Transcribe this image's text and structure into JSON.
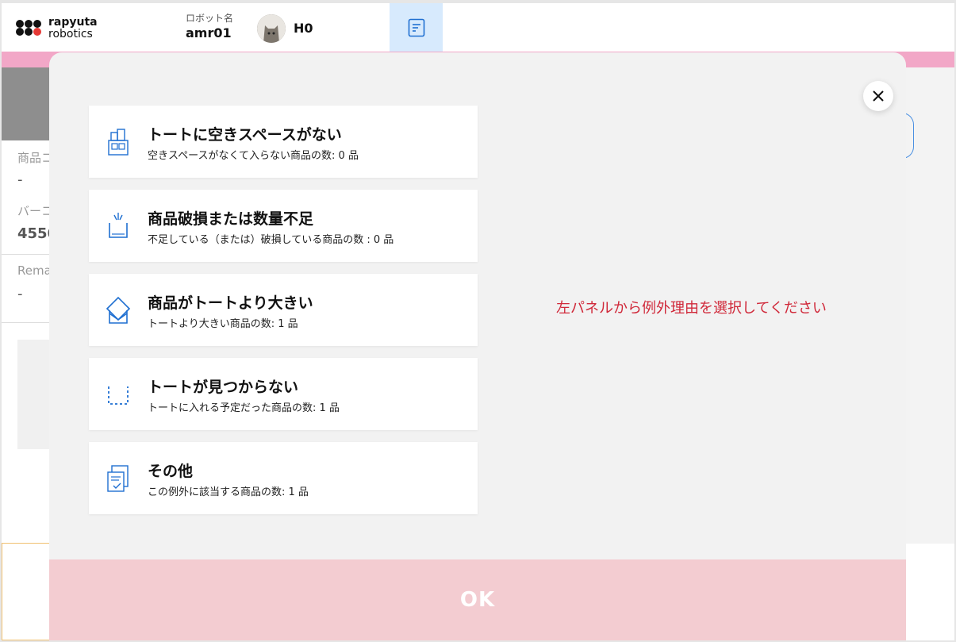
{
  "header": {
    "brand_line1": "rapyuta",
    "brand_line2": "robotics",
    "robot_label": "ロボット名",
    "robot_name": "amr01",
    "user_name": "H0"
  },
  "background": {
    "label_product": "商品コ",
    "value_product": "-",
    "label_barcode": "バーコ",
    "value_barcode": "4550",
    "label_remarks": "Rema",
    "value_remarks": "-"
  },
  "modal": {
    "reasons": [
      {
        "icon": "tote-full-icon",
        "title": "トートに空きスペースがない",
        "subtitle": "空きスペースがなくて入らない商品の数: 0 品"
      },
      {
        "icon": "damaged-item-icon",
        "title": "商品破損または数量不足",
        "subtitle": "不足している（または）破損している商品の数 : 0 品"
      },
      {
        "icon": "oversized-item-icon",
        "title": "商品がトートより大きい",
        "subtitle": "トートより大きい商品の数: 1 品"
      },
      {
        "icon": "missing-tote-icon",
        "title": "トートが見つからない",
        "subtitle": "トートに入れる予定だった商品の数: 1 品"
      },
      {
        "icon": "other-checklist-icon",
        "title": "その他",
        "subtitle": "この例外に該当する商品の数: 1 品"
      }
    ],
    "hint": "左パネルから例外理由を選択してください",
    "ok_label": "OK"
  },
  "colors": {
    "accent_blue": "#1f6fd1",
    "header_pink": "#f2a7c7",
    "ok_disabled": "#f3ccd1",
    "hint_red": "#d0293a"
  }
}
